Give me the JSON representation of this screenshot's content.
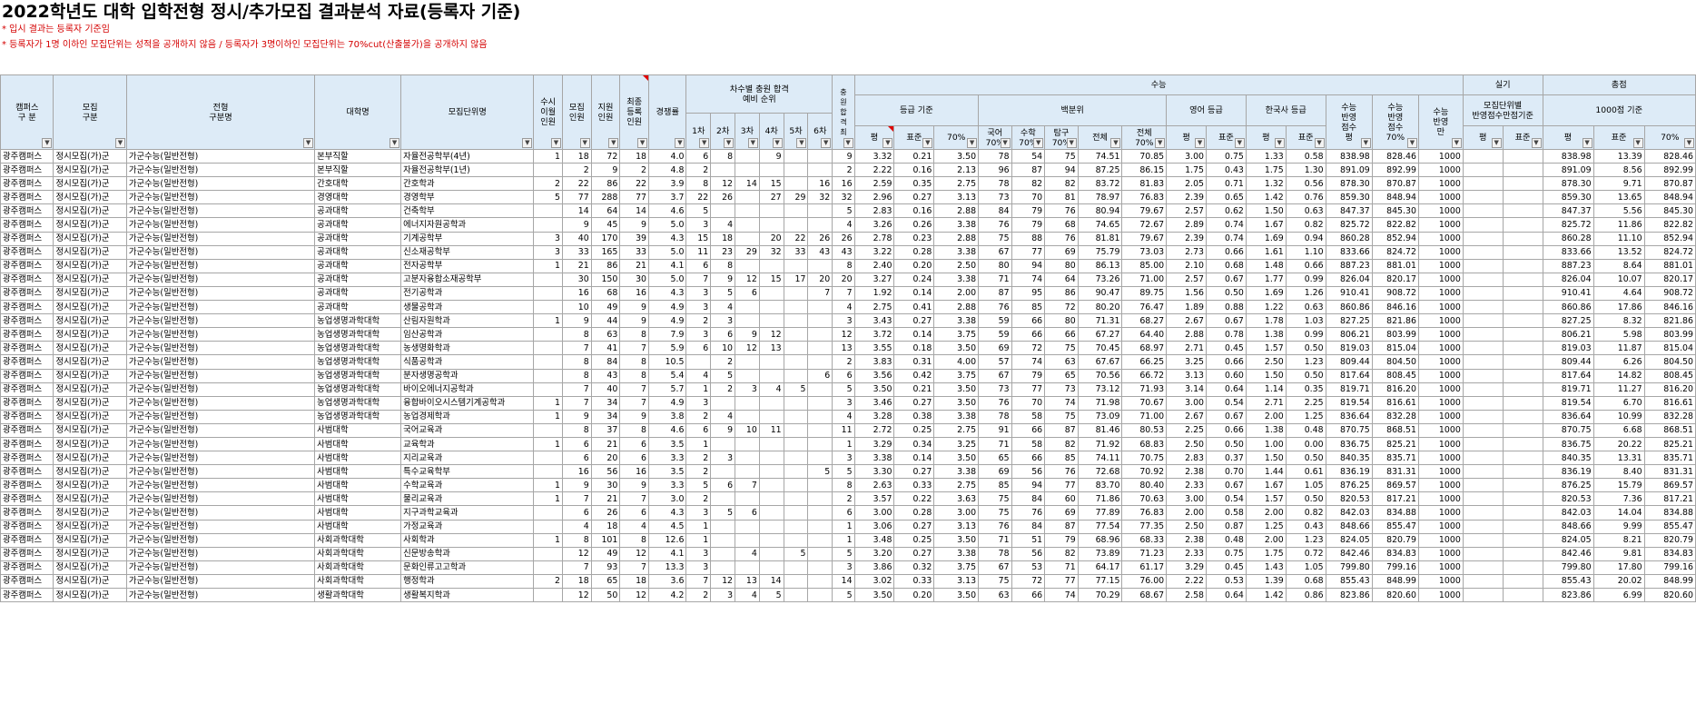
{
  "title": "2022학년도 대학 입학전형 정시/추가모집 결과분석 자료(등록자 기준)",
  "notes": [
    "* 입시 결과는 등록자 기준임",
    "* 등록자가 1명 이하인 모집단위는 성적을 공개하지 않음 / 등록자가 3명이하인 모집단위는 70%cut(산출불가)을 공개하지 않음"
  ],
  "header": {
    "campus": "캠퍼스\n구 분",
    "recruit": "모집\n구분",
    "type": "전형\n구분명",
    "college": "대학명",
    "major": "모집단위명",
    "carry": "수시\n이월\n인원",
    "quota": "모집\n인원",
    "applicants": "지원\n인원",
    "final_reg": "최종\n등록\n인원",
    "competition": "경쟁률",
    "round_group": "차수별 충원 합격\n예비 순위",
    "rounds": [
      "1차",
      "2차",
      "3차",
      "4차",
      "5차",
      "6차"
    ],
    "total_round": "충\n원\n합\n격\n최",
    "suneung": "수능",
    "grade_basis": "등급 기준",
    "percentile": "백분위",
    "english": "영어 등급",
    "history": "한국사 등급",
    "score1": "수능\n반영\n점수\n평",
    "score2": "수능\n반영\n점수\n70%",
    "score3": "수능\n반영\n만",
    "practical": "실기",
    "practical_sub": "모집단위별\n반영점수만점기준",
    "total": "총점",
    "total_sub": "1000점 기준",
    "avg": "평",
    "std": "표준",
    "cut70": "70%",
    "kor": "국어\n70%",
    "math": "수학\n70%",
    "inq": "탐구\n70%",
    "all": "전체",
    "all70": "전체\n70%"
  },
  "rows": [
    [
      "광주캠퍼스",
      "정시모집(가)군",
      "가군수능(일반전형)",
      "본부직할",
      "자율전공학부(4년)",
      "1",
      "18",
      "72",
      "18",
      "4.0",
      "6",
      "8",
      "",
      "9",
      "",
      "",
      "9",
      "3.32",
      "0.21",
      "3.50",
      "78",
      "54",
      "75",
      "74.51",
      "70.85",
      "3.00",
      "0.75",
      "1.33",
      "0.58",
      "838.98",
      "828.46",
      "1000",
      "",
      "",
      "838.98",
      "13.39",
      "828.46"
    ],
    [
      "광주캠퍼스",
      "정시모집(가)군",
      "가군수능(일반전형)",
      "본부직할",
      "자율전공학부(1년)",
      "",
      "2",
      "9",
      "2",
      "4.8",
      "2",
      "",
      "",
      "",
      "",
      "",
      "2",
      "2.22",
      "0.16",
      "2.13",
      "96",
      "87",
      "94",
      "87.25",
      "86.15",
      "1.75",
      "0.43",
      "1.75",
      "1.30",
      "891.09",
      "892.99",
      "1000",
      "",
      "",
      "891.09",
      "8.56",
      "892.99"
    ],
    [
      "광주캠퍼스",
      "정시모집(가)군",
      "가군수능(일반전형)",
      "간호대학",
      "간호학과",
      "2",
      "22",
      "86",
      "22",
      "3.9",
      "8",
      "12",
      "14",
      "15",
      "",
      "16",
      "16",
      "2.59",
      "0.35",
      "2.75",
      "78",
      "82",
      "82",
      "83.72",
      "81.83",
      "2.05",
      "0.71",
      "1.32",
      "0.56",
      "878.30",
      "870.87",
      "1000",
      "",
      "",
      "878.30",
      "9.71",
      "870.87"
    ],
    [
      "광주캠퍼스",
      "정시모집(가)군",
      "가군수능(일반전형)",
      "경영대학",
      "경영학부",
      "5",
      "77",
      "288",
      "77",
      "3.7",
      "22",
      "26",
      "",
      "27",
      "29",
      "32",
      "32",
      "2.96",
      "0.27",
      "3.13",
      "73",
      "70",
      "81",
      "78.97",
      "76.83",
      "2.39",
      "0.65",
      "1.42",
      "0.76",
      "859.30",
      "848.94",
      "1000",
      "",
      "",
      "859.30",
      "13.65",
      "848.94"
    ],
    [
      "광주캠퍼스",
      "정시모집(가)군",
      "가군수능(일반전형)",
      "공과대학",
      "건축학부",
      "",
      "14",
      "64",
      "14",
      "4.6",
      "5",
      "",
      "",
      "",
      "",
      "",
      "5",
      "2.83",
      "0.16",
      "2.88",
      "84",
      "79",
      "76",
      "80.94",
      "79.67",
      "2.57",
      "0.62",
      "1.50",
      "0.63",
      "847.37",
      "845.30",
      "1000",
      "",
      "",
      "847.37",
      "5.56",
      "845.30"
    ],
    [
      "광주캠퍼스",
      "정시모집(가)군",
      "가군수능(일반전형)",
      "공과대학",
      "에너지자원공학과",
      "",
      "9",
      "45",
      "9",
      "5.0",
      "3",
      "4",
      "",
      "",
      "",
      "",
      "4",
      "3.26",
      "0.26",
      "3.38",
      "76",
      "79",
      "68",
      "74.65",
      "72.67",
      "2.89",
      "0.74",
      "1.67",
      "0.82",
      "825.72",
      "822.82",
      "1000",
      "",
      "",
      "825.72",
      "11.86",
      "822.82"
    ],
    [
      "광주캠퍼스",
      "정시모집(가)군",
      "가군수능(일반전형)",
      "공과대학",
      "기계공학부",
      "3",
      "40",
      "170",
      "39",
      "4.3",
      "15",
      "18",
      "",
      "20",
      "22",
      "26",
      "26",
      "2.78",
      "0.23",
      "2.88",
      "75",
      "88",
      "76",
      "81.81",
      "79.67",
      "2.39",
      "0.74",
      "1.69",
      "0.94",
      "860.28",
      "852.94",
      "1000",
      "",
      "",
      "860.28",
      "11.10",
      "852.94"
    ],
    [
      "광주캠퍼스",
      "정시모집(가)군",
      "가군수능(일반전형)",
      "공과대학",
      "신소재공학부",
      "3",
      "33",
      "165",
      "33",
      "5.0",
      "11",
      "23",
      "29",
      "32",
      "33",
      "43",
      "43",
      "3.22",
      "0.28",
      "3.38",
      "67",
      "77",
      "69",
      "75.79",
      "73.03",
      "2.73",
      "0.66",
      "1.61",
      "1.10",
      "833.66",
      "824.72",
      "1000",
      "",
      "",
      "833.66",
      "13.52",
      "824.72"
    ],
    [
      "광주캠퍼스",
      "정시모집(가)군",
      "가군수능(일반전형)",
      "공과대학",
      "전자공학부",
      "1",
      "21",
      "86",
      "21",
      "4.1",
      "6",
      "8",
      "",
      "",
      "",
      "",
      "8",
      "2.40",
      "0.20",
      "2.50",
      "80",
      "94",
      "80",
      "86.13",
      "85.00",
      "2.10",
      "0.68",
      "1.48",
      "0.66",
      "887.23",
      "881.01",
      "1000",
      "",
      "",
      "887.23",
      "8.64",
      "881.01"
    ],
    [
      "광주캠퍼스",
      "정시모집(가)군",
      "가군수능(일반전형)",
      "공과대학",
      "고분자융합소재공학부",
      "",
      "30",
      "150",
      "30",
      "5.0",
      "7",
      "9",
      "12",
      "15",
      "17",
      "20",
      "20",
      "3.27",
      "0.24",
      "3.38",
      "71",
      "74",
      "64",
      "73.26",
      "71.00",
      "2.57",
      "0.67",
      "1.77",
      "0.99",
      "826.04",
      "820.17",
      "1000",
      "",
      "",
      "826.04",
      "10.07",
      "820.17"
    ],
    [
      "광주캠퍼스",
      "정시모집(가)군",
      "가군수능(일반전형)",
      "공과대학",
      "전기공학과",
      "",
      "16",
      "68",
      "16",
      "4.3",
      "3",
      "5",
      "6",
      "",
      "",
      "7",
      "7",
      "1.92",
      "0.14",
      "2.00",
      "87",
      "95",
      "86",
      "90.47",
      "89.75",
      "1.56",
      "0.50",
      "1.69",
      "1.26",
      "910.41",
      "908.72",
      "1000",
      "",
      "",
      "910.41",
      "4.64",
      "908.72"
    ],
    [
      "광주캠퍼스",
      "정시모집(가)군",
      "가군수능(일반전형)",
      "공과대학",
      "생물공학과",
      "",
      "10",
      "49",
      "9",
      "4.9",
      "3",
      "4",
      "",
      "",
      "",
      "",
      "4",
      "2.75",
      "0.41",
      "2.88",
      "76",
      "85",
      "72",
      "80.20",
      "76.47",
      "1.89",
      "0.88",
      "1.22",
      "0.63",
      "860.86",
      "846.16",
      "1000",
      "",
      "",
      "860.86",
      "17.86",
      "846.16"
    ],
    [
      "광주캠퍼스",
      "정시모집(가)군",
      "가군수능(일반전형)",
      "농업생명과학대학",
      "산림자원학과",
      "1",
      "9",
      "44",
      "9",
      "4.9",
      "2",
      "3",
      "",
      "",
      "",
      "",
      "3",
      "3.43",
      "0.27",
      "3.38",
      "59",
      "66",
      "80",
      "71.31",
      "68.27",
      "2.67",
      "0.67",
      "1.78",
      "1.03",
      "827.25",
      "821.86",
      "1000",
      "",
      "",
      "827.25",
      "8.32",
      "821.86"
    ],
    [
      "광주캠퍼스",
      "정시모집(가)군",
      "가군수능(일반전형)",
      "농업생명과학대학",
      "임산공학과",
      "",
      "8",
      "63",
      "8",
      "7.9",
      "3",
      "6",
      "9",
      "12",
      "",
      "",
      "12",
      "3.72",
      "0.14",
      "3.75",
      "59",
      "66",
      "66",
      "67.27",
      "64.40",
      "2.88",
      "0.78",
      "1.38",
      "0.99",
      "806.21",
      "803.99",
      "1000",
      "",
      "",
      "806.21",
      "5.98",
      "803.99"
    ],
    [
      "광주캠퍼스",
      "정시모집(가)군",
      "가군수능(일반전형)",
      "농업생명과학대학",
      "농생명화학과",
      "",
      "7",
      "41",
      "7",
      "5.9",
      "6",
      "10",
      "12",
      "13",
      "",
      "",
      "13",
      "3.55",
      "0.18",
      "3.50",
      "69",
      "72",
      "75",
      "70.45",
      "68.97",
      "2.71",
      "0.45",
      "1.57",
      "0.50",
      "819.03",
      "815.04",
      "1000",
      "",
      "",
      "819.03",
      "11.87",
      "815.04"
    ],
    [
      "광주캠퍼스",
      "정시모집(가)군",
      "가군수능(일반전형)",
      "농업생명과학대학",
      "식품공학과",
      "",
      "8",
      "84",
      "8",
      "10.5",
      "",
      "2",
      "",
      "",
      "",
      "",
      "2",
      "3.83",
      "0.31",
      "4.00",
      "57",
      "74",
      "63",
      "67.67",
      "66.25",
      "3.25",
      "0.66",
      "2.50",
      "1.23",
      "809.44",
      "804.50",
      "1000",
      "",
      "",
      "809.44",
      "6.26",
      "804.50"
    ],
    [
      "광주캠퍼스",
      "정시모집(가)군",
      "가군수능(일반전형)",
      "농업생명과학대학",
      "분자생명공학과",
      "",
      "8",
      "43",
      "8",
      "5.4",
      "4",
      "5",
      "",
      "",
      "",
      "6",
      "6",
      "3.56",
      "0.42",
      "3.75",
      "67",
      "79",
      "65",
      "70.56",
      "66.72",
      "3.13",
      "0.60",
      "1.50",
      "0.50",
      "817.64",
      "808.45",
      "1000",
      "",
      "",
      "817.64",
      "14.82",
      "808.45"
    ],
    [
      "광주캠퍼스",
      "정시모집(가)군",
      "가군수능(일반전형)",
      "농업생명과학대학",
      "바이오에너지공학과",
      "",
      "7",
      "40",
      "7",
      "5.7",
      "1",
      "2",
      "3",
      "4",
      "5",
      "",
      "5",
      "3.50",
      "0.21",
      "3.50",
      "73",
      "77",
      "73",
      "73.12",
      "71.93",
      "3.14",
      "0.64",
      "1.14",
      "0.35",
      "819.71",
      "816.20",
      "1000",
      "",
      "",
      "819.71",
      "11.27",
      "816.20"
    ],
    [
      "광주캠퍼스",
      "정시모집(가)군",
      "가군수능(일반전형)",
      "농업생명과학대학",
      "융합바이오시스템기계공학과",
      "1",
      "7",
      "34",
      "7",
      "4.9",
      "3",
      "",
      "",
      "",
      "",
      "",
      "3",
      "3.46",
      "0.27",
      "3.50",
      "76",
      "70",
      "74",
      "71.98",
      "70.67",
      "3.00",
      "0.54",
      "2.71",
      "2.25",
      "819.54",
      "816.61",
      "1000",
      "",
      "",
      "819.54",
      "6.70",
      "816.61"
    ],
    [
      "광주캠퍼스",
      "정시모집(가)군",
      "가군수능(일반전형)",
      "농업생명과학대학",
      "농업경제학과",
      "1",
      "9",
      "34",
      "9",
      "3.8",
      "2",
      "4",
      "",
      "",
      "",
      "",
      "4",
      "3.28",
      "0.38",
      "3.38",
      "78",
      "58",
      "75",
      "73.09",
      "71.00",
      "2.67",
      "0.67",
      "2.00",
      "1.25",
      "836.64",
      "832.28",
      "1000",
      "",
      "",
      "836.64",
      "10.99",
      "832.28"
    ],
    [
      "광주캠퍼스",
      "정시모집(가)군",
      "가군수능(일반전형)",
      "사범대학",
      "국어교육과",
      "",
      "8",
      "37",
      "8",
      "4.6",
      "6",
      "9",
      "10",
      "11",
      "",
      "",
      "11",
      "2.72",
      "0.25",
      "2.75",
      "91",
      "66",
      "87",
      "81.46",
      "80.53",
      "2.25",
      "0.66",
      "1.38",
      "0.48",
      "870.75",
      "868.51",
      "1000",
      "",
      "",
      "870.75",
      "6.68",
      "868.51"
    ],
    [
      "광주캠퍼스",
      "정시모집(가)군",
      "가군수능(일반전형)",
      "사범대학",
      "교육학과",
      "1",
      "6",
      "21",
      "6",
      "3.5",
      "1",
      "",
      "",
      "",
      "",
      "",
      "1",
      "3.29",
      "0.34",
      "3.25",
      "71",
      "58",
      "82",
      "71.92",
      "68.83",
      "2.50",
      "0.50",
      "1.00",
      "0.00",
      "836.75",
      "825.21",
      "1000",
      "",
      "",
      "836.75",
      "20.22",
      "825.21"
    ],
    [
      "광주캠퍼스",
      "정시모집(가)군",
      "가군수능(일반전형)",
      "사범대학",
      "지리교육과",
      "",
      "6",
      "20",
      "6",
      "3.3",
      "2",
      "3",
      "",
      "",
      "",
      "",
      "3",
      "3.38",
      "0.14",
      "3.50",
      "65",
      "66",
      "85",
      "74.11",
      "70.75",
      "2.83",
      "0.37",
      "1.50",
      "0.50",
      "840.35",
      "835.71",
      "1000",
      "",
      "",
      "840.35",
      "13.31",
      "835.71"
    ],
    [
      "광주캠퍼스",
      "정시모집(가)군",
      "가군수능(일반전형)",
      "사범대학",
      "특수교육학부",
      "",
      "16",
      "56",
      "16",
      "3.5",
      "2",
      "",
      "",
      "",
      "",
      "5",
      "5",
      "3.30",
      "0.27",
      "3.38",
      "69",
      "56",
      "76",
      "72.68",
      "70.92",
      "2.38",
      "0.70",
      "1.44",
      "0.61",
      "836.19",
      "831.31",
      "1000",
      "",
      "",
      "836.19",
      "8.40",
      "831.31"
    ],
    [
      "광주캠퍼스",
      "정시모집(가)군",
      "가군수능(일반전형)",
      "사범대학",
      "수학교육과",
      "1",
      "9",
      "30",
      "9",
      "3.3",
      "5",
      "6",
      "7",
      "",
      "",
      "",
      "8",
      "2.63",
      "0.33",
      "2.75",
      "85",
      "94",
      "77",
      "83.70",
      "80.40",
      "2.33",
      "0.67",
      "1.67",
      "1.05",
      "876.25",
      "869.57",
      "1000",
      "",
      "",
      "876.25",
      "15.79",
      "869.57"
    ],
    [
      "광주캠퍼스",
      "정시모집(가)군",
      "가군수능(일반전형)",
      "사범대학",
      "물리교육과",
      "1",
      "7",
      "21",
      "7",
      "3.0",
      "2",
      "",
      "",
      "",
      "",
      "",
      "2",
      "3.57",
      "0.22",
      "3.63",
      "75",
      "84",
      "60",
      "71.86",
      "70.63",
      "3.00",
      "0.54",
      "1.57",
      "0.50",
      "820.53",
      "817.21",
      "1000",
      "",
      "",
      "820.53",
      "7.36",
      "817.21"
    ],
    [
      "광주캠퍼스",
      "정시모집(가)군",
      "가군수능(일반전형)",
      "사범대학",
      "지구과학교육과",
      "",
      "6",
      "26",
      "6",
      "4.3",
      "3",
      "5",
      "6",
      "",
      "",
      "",
      "6",
      "3.00",
      "0.28",
      "3.00",
      "75",
      "76",
      "69",
      "77.89",
      "76.83",
      "2.00",
      "0.58",
      "2.00",
      "0.82",
      "842.03",
      "834.88",
      "1000",
      "",
      "",
      "842.03",
      "14.04",
      "834.88"
    ],
    [
      "광주캠퍼스",
      "정시모집(가)군",
      "가군수능(일반전형)",
      "사범대학",
      "가정교육과",
      "",
      "4",
      "18",
      "4",
      "4.5",
      "1",
      "",
      "",
      "",
      "",
      "",
      "1",
      "3.06",
      "0.27",
      "3.13",
      "76",
      "84",
      "87",
      "77.54",
      "77.35",
      "2.50",
      "0.87",
      "1.25",
      "0.43",
      "848.66",
      "855.47",
      "1000",
      "",
      "",
      "848.66",
      "9.99",
      "855.47"
    ],
    [
      "광주캠퍼스",
      "정시모집(가)군",
      "가군수능(일반전형)",
      "사회과학대학",
      "사회학과",
      "1",
      "8",
      "101",
      "8",
      "12.6",
      "1",
      "",
      "",
      "",
      "",
      "",
      "1",
      "3.48",
      "0.25",
      "3.50",
      "71",
      "51",
      "79",
      "68.96",
      "68.33",
      "2.38",
      "0.48",
      "2.00",
      "1.23",
      "824.05",
      "820.79",
      "1000",
      "",
      "",
      "824.05",
      "8.21",
      "820.79"
    ],
    [
      "광주캠퍼스",
      "정시모집(가)군",
      "가군수능(일반전형)",
      "사회과학대학",
      "신문방송학과",
      "",
      "12",
      "49",
      "12",
      "4.1",
      "3",
      "",
      "4",
      "",
      "5",
      "",
      "5",
      "3.20",
      "0.27",
      "3.38",
      "78",
      "56",
      "82",
      "73.89",
      "71.23",
      "2.33",
      "0.75",
      "1.75",
      "0.72",
      "842.46",
      "834.83",
      "1000",
      "",
      "",
      "842.46",
      "9.81",
      "834.83"
    ],
    [
      "광주캠퍼스",
      "정시모집(가)군",
      "가군수능(일반전형)",
      "사회과학대학",
      "문화인류고고학과",
      "",
      "7",
      "93",
      "7",
      "13.3",
      "3",
      "",
      "",
      "",
      "",
      "",
      "3",
      "3.86",
      "0.32",
      "3.75",
      "67",
      "53",
      "71",
      "64.17",
      "61.17",
      "3.29",
      "0.45",
      "1.43",
      "1.05",
      "799.80",
      "799.16",
      "1000",
      "",
      "",
      "799.80",
      "17.80",
      "799.16"
    ],
    [
      "광주캠퍼스",
      "정시모집(가)군",
      "가군수능(일반전형)",
      "사회과학대학",
      "행정학과",
      "2",
      "18",
      "65",
      "18",
      "3.6",
      "7",
      "12",
      "13",
      "14",
      "",
      "",
      "14",
      "3.02",
      "0.33",
      "3.13",
      "75",
      "72",
      "77",
      "77.15",
      "76.00",
      "2.22",
      "0.53",
      "1.39",
      "0.68",
      "855.43",
      "848.99",
      "1000",
      "",
      "",
      "855.43",
      "20.02",
      "848.99"
    ],
    [
      "광주캠퍼스",
      "정시모집(가)군",
      "가군수능(일반전형)",
      "생활과학대학",
      "생활복지학과",
      "",
      "12",
      "50",
      "12",
      "4.2",
      "2",
      "3",
      "4",
      "5",
      "",
      "",
      "5",
      "3.50",
      "0.20",
      "3.50",
      "63",
      "66",
      "74",
      "70.29",
      "68.67",
      "2.58",
      "0.64",
      "1.42",
      "0.86",
      "823.86",
      "820.60",
      "1000",
      "",
      "",
      "823.86",
      "6.99",
      "820.60"
    ]
  ]
}
